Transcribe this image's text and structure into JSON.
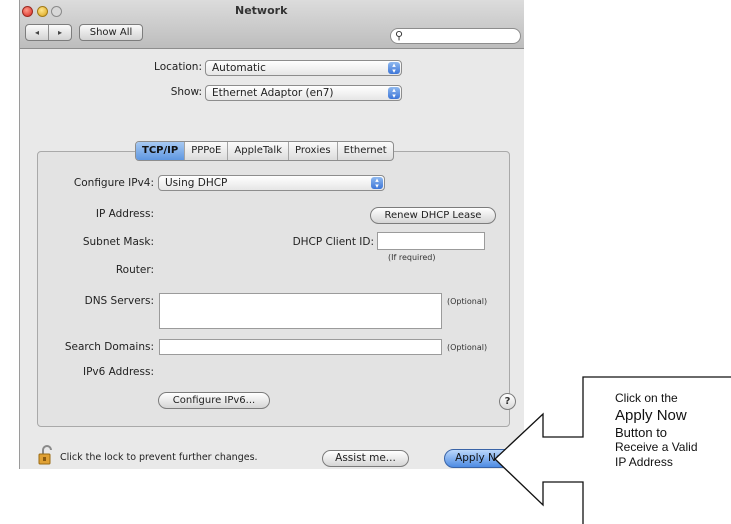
{
  "window": {
    "title": "Network",
    "nav_back": "◂",
    "nav_forward": "▸",
    "show_all": "Show All",
    "search_placeholder": ""
  },
  "location": {
    "label": "Location:",
    "value": "Automatic"
  },
  "show": {
    "label": "Show:",
    "value": "Ethernet Adaptor (en7)"
  },
  "tabs": [
    {
      "label": "TCP/IP",
      "selected": true
    },
    {
      "label": "PPPoE",
      "selected": false
    },
    {
      "label": "AppleTalk",
      "selected": false
    },
    {
      "label": "Proxies",
      "selected": false
    },
    {
      "label": "Ethernet",
      "selected": false
    }
  ],
  "tcpip": {
    "configure_label": "Configure IPv4:",
    "configure_value": "Using DHCP",
    "ip_label": "IP Address:",
    "renew_button": "Renew DHCP Lease",
    "subnet_label": "Subnet Mask:",
    "dhcp_client_label": "DHCP Client ID:",
    "dhcp_client_value": "",
    "if_required": "(If required)",
    "router_label": "Router:",
    "dns_label": "DNS Servers:",
    "dns_value": "",
    "optional_1": "(Optional)",
    "search_domains_label": "Search Domains:",
    "search_domains_value": "",
    "optional_2": "(Optional)",
    "ipv6_label": "IPv6 Address:",
    "configure_ipv6_button": "Configure IPv6...",
    "help": "?"
  },
  "footer": {
    "lock_text": "Click the lock to prevent further changes.",
    "assist_button": "Assist me...",
    "apply_button": "Apply Now"
  },
  "callout": {
    "line1": "Click on the",
    "line2": "Apply Now",
    "line3": "Button to",
    "line4": "Receive a Valid",
    "line5": "IP Address"
  }
}
